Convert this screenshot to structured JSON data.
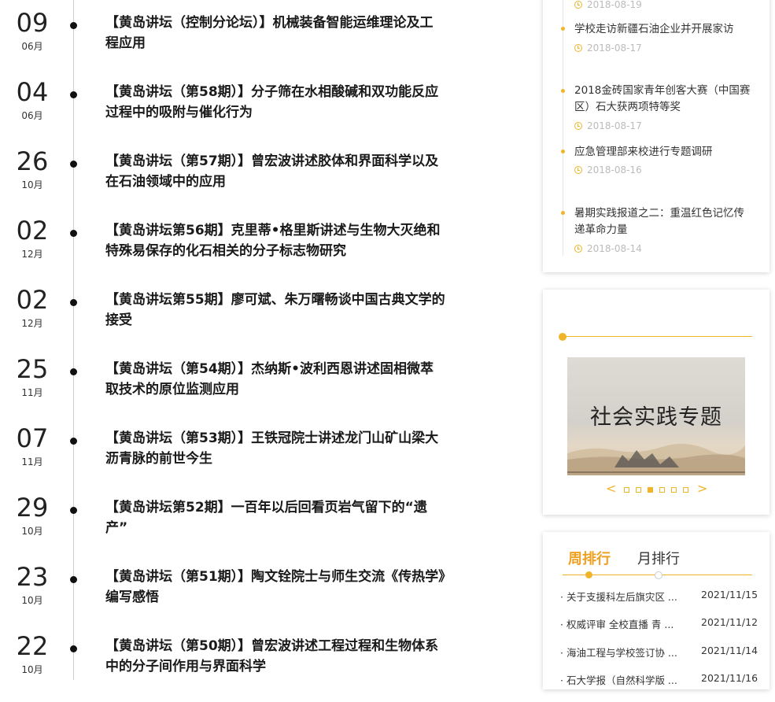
{
  "lectures": [
    {
      "day": "09",
      "month": "06月",
      "title": "【黄岛讲坛（控制分论坛）】机械装备智能运维理论及工程应用"
    },
    {
      "day": "04",
      "month": "06月",
      "title": "【黄岛讲坛（第58期）】分子筛在水相酸碱和双功能反应过程中的吸附与催化行为"
    },
    {
      "day": "26",
      "month": "10月",
      "title": "【黄岛讲坛（第57期）】曾宏波讲述胶体和界面科学以及在石油领域中的应用"
    },
    {
      "day": "02",
      "month": "12月",
      "title": "【黄岛讲坛第56期】克里蒂•格里斯讲述与生物大灭绝和特殊易保存的化石相关的分子标志物研究"
    },
    {
      "day": "02",
      "month": "12月",
      "title": "【黄岛讲坛第55期】廖可斌、朱万曙畅谈中国古典文学的接受"
    },
    {
      "day": "25",
      "month": "11月",
      "title": "【黄岛讲坛（第54期）】杰纳斯•波利西恩讲述固相微萃取技术的原位监测应用"
    },
    {
      "day": "07",
      "month": "11月",
      "title": "【黄岛讲坛（第53期）】王铁冠院士讲述龙门山矿山梁大沥青脉的前世今生"
    },
    {
      "day": "29",
      "month": "10月",
      "title": "【黄岛讲坛第52期】一百年以后回看页岩气留下的“遗产”"
    },
    {
      "day": "23",
      "month": "10月",
      "title": "【黄岛讲坛（第51期）】陶文铨院士与师生交流《传热学》编写感悟"
    },
    {
      "day": "22",
      "month": "10月",
      "title": "【黄岛讲坛（第50期）】曾宏波讲述工程过程和生物体系中的分子间作用与界面科学"
    }
  ],
  "news": [
    {
      "title": "",
      "date": "2018-08-19"
    },
    {
      "title": "学校走访新疆石油企业并开展家访",
      "date": "2018-08-17"
    },
    {
      "title": "2018金砖国家青年创客大赛（中国赛区）石大获两项特等奖",
      "date": "2018-08-17"
    },
    {
      "title": "应急管理部来校进行专题调研",
      "date": "2018-08-16"
    },
    {
      "title": "暑期实践报道之二：重温红色记忆传递革命力量",
      "date": "2018-08-14"
    }
  ],
  "slider": {
    "banner_text": "社会实践专题",
    "prev": "<",
    "next": ">",
    "active_index": 2,
    "count": 6
  },
  "ranking": {
    "tabs": [
      "周排行",
      "月排行"
    ],
    "items": [
      {
        "title": "· 关于支援科左后旗灾区 ...",
        "date": "2021/11/15"
      },
      {
        "title": "· 权威评审 全校直播 青 ...",
        "date": "2021/11/12"
      },
      {
        "title": "· 海油工程与学校签订协 ...",
        "date": "2021/11/14"
      },
      {
        "title": "· 石大学报（自然科学版 ...",
        "date": "2021/11/16"
      }
    ]
  },
  "colors": {
    "accent": "#f0b429",
    "tab_active": "#f0a020",
    "timeline_dot": "#111111"
  }
}
